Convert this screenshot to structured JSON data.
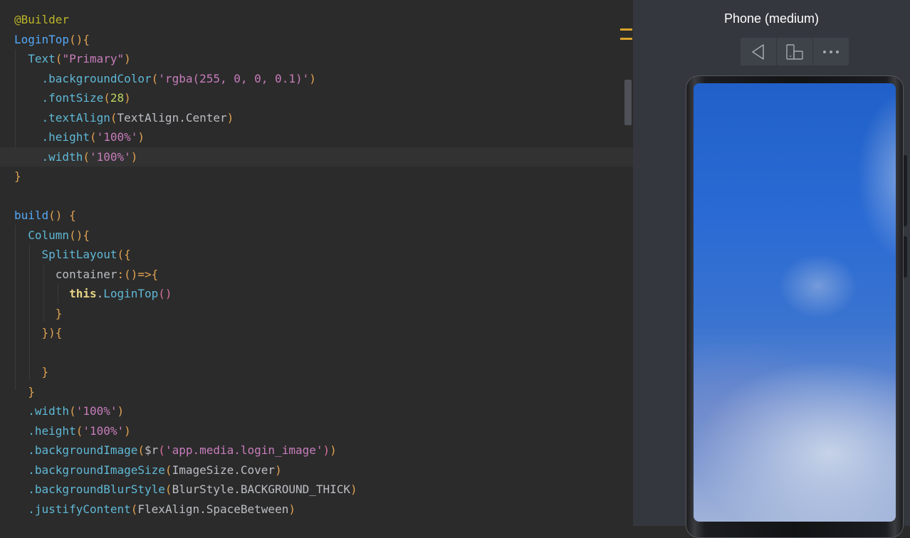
{
  "editor": {
    "lines": [
      [
        [
          "t-anno",
          "@Builder"
        ]
      ],
      [
        [
          "t-fn",
          "LoginTop"
        ],
        [
          "t-paren",
          "(){"
        ]
      ],
      [
        [
          "t-plain",
          "  "
        ],
        [
          "t-call",
          "Text"
        ],
        [
          "t-paren",
          "("
        ],
        [
          "t-str2",
          "\"Primary\""
        ],
        [
          "t-paren",
          ")"
        ]
      ],
      [
        [
          "t-plain",
          "    "
        ],
        [
          "t-call",
          ".backgroundColor"
        ],
        [
          "t-paren",
          "("
        ],
        [
          "t-str2",
          "'rgba(255, 0, 0, 0.1)'"
        ],
        [
          "t-paren",
          ")"
        ]
      ],
      [
        [
          "t-plain",
          "    "
        ],
        [
          "t-call",
          ".fontSize"
        ],
        [
          "t-paren",
          "("
        ],
        [
          "t-num",
          "28"
        ],
        [
          "t-paren",
          ")"
        ]
      ],
      [
        [
          "t-plain",
          "    "
        ],
        [
          "t-call",
          ".textAlign"
        ],
        [
          "t-paren",
          "("
        ],
        [
          "t-plain",
          "TextAlign.Center"
        ],
        [
          "t-paren",
          ")"
        ]
      ],
      [
        [
          "t-plain",
          "    "
        ],
        [
          "t-call",
          ".height"
        ],
        [
          "t-paren",
          "("
        ],
        [
          "t-str2",
          "'100%'"
        ],
        [
          "t-paren",
          ")"
        ]
      ],
      [
        [
          "t-plain",
          "    "
        ],
        [
          "t-call",
          ".width"
        ],
        [
          "t-paren",
          "("
        ],
        [
          "t-str2",
          "'100%'"
        ],
        [
          "t-paren",
          ")"
        ]
      ],
      [
        [
          "gold",
          "}"
        ]
      ],
      [],
      [
        [
          "t-fn",
          "build"
        ],
        [
          "t-paren",
          "() {"
        ]
      ],
      [
        [
          "t-plain",
          "  "
        ],
        [
          "t-call",
          "Column"
        ],
        [
          "t-paren",
          "(){"
        ]
      ],
      [
        [
          "t-plain",
          "    "
        ],
        [
          "t-call",
          "SplitLayout"
        ],
        [
          "t-paren",
          "({"
        ]
      ],
      [
        [
          "t-plain",
          "      container"
        ],
        [
          "t-paren",
          ":()=>{"
        ]
      ],
      [
        [
          "t-plain",
          "        "
        ],
        [
          "t-kw",
          "this"
        ],
        [
          "t-plain",
          "."
        ],
        [
          "t-call",
          "LoginTop"
        ],
        [
          "t-paren2",
          "()"
        ]
      ],
      [
        [
          "t-plain",
          "      "
        ],
        [
          "gold",
          "}"
        ]
      ],
      [
        [
          "t-plain",
          "    "
        ],
        [
          "t-paren",
          "}){"
        ]
      ],
      [],
      [
        [
          "t-plain",
          "    "
        ],
        [
          "gold",
          "}"
        ]
      ],
      [
        [
          "t-plain",
          "  "
        ],
        [
          "gold",
          "}"
        ]
      ],
      [
        [
          "t-plain",
          "  "
        ],
        [
          "t-call",
          ".width"
        ],
        [
          "t-paren",
          "("
        ],
        [
          "t-str2",
          "'100%'"
        ],
        [
          "t-paren",
          ")"
        ]
      ],
      [
        [
          "t-plain",
          "  "
        ],
        [
          "t-call",
          ".height"
        ],
        [
          "t-paren",
          "("
        ],
        [
          "t-str2",
          "'100%'"
        ],
        [
          "t-paren",
          ")"
        ]
      ],
      [
        [
          "t-plain",
          "  "
        ],
        [
          "t-call",
          ".backgroundImage"
        ],
        [
          "t-paren",
          "("
        ],
        [
          "t-plain",
          "$r"
        ],
        [
          "t-paren2",
          "("
        ],
        [
          "t-str2",
          "'app.media.login_image'"
        ],
        [
          "t-paren2",
          ")"
        ],
        [
          "t-paren",
          ")"
        ]
      ],
      [
        [
          "t-plain",
          "  "
        ],
        [
          "t-call",
          ".backgroundImageSize"
        ],
        [
          "t-paren",
          "("
        ],
        [
          "t-plain",
          "ImageSize.Cover"
        ],
        [
          "t-paren",
          ")"
        ]
      ],
      [
        [
          "t-plain",
          "  "
        ],
        [
          "t-call",
          ".backgroundBlurStyle"
        ],
        [
          "t-paren",
          "("
        ],
        [
          "t-plain",
          "BlurStyle.BACKGROUND_THICK"
        ],
        [
          "t-paren",
          ")"
        ]
      ],
      [
        [
          "t-plain",
          "  "
        ],
        [
          "t-call",
          ".justifyContent"
        ],
        [
          "t-paren",
          "("
        ],
        [
          "t-plain",
          "FlexAlign.SpaceBetween"
        ],
        [
          "t-paren",
          ")"
        ]
      ]
    ],
    "current_line": 7
  },
  "previewer": {
    "title": "Phone (medium)",
    "toolbar": [
      {
        "icon": "back-triangle-icon"
      },
      {
        "icon": "device-switch-icon"
      },
      {
        "icon": "more-dots-icon"
      }
    ]
  }
}
